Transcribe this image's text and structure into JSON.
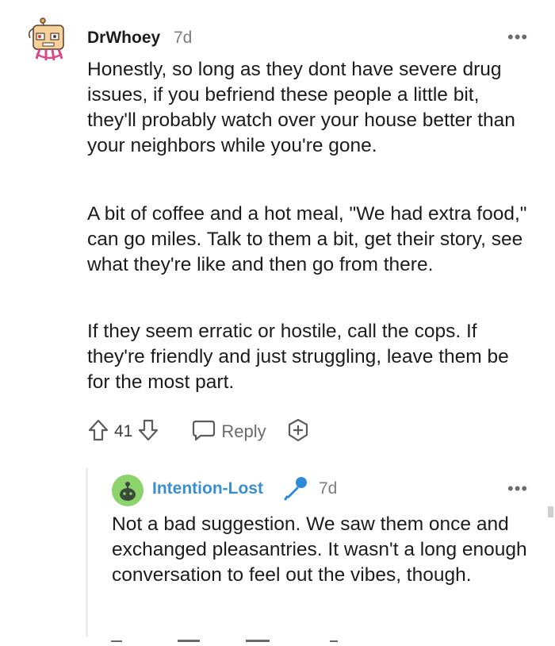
{
  "comment": {
    "username": "DrWhoey",
    "age": "7d",
    "more": "•••",
    "paragraphs": [
      "Honestly, so long as they dont have severe drug issues, if you befriend these people a little bit, they'll probably watch over your house better than your neighbors while you're gone.",
      "A bit of coffee and a hot meal, \"We had extra food,\" can go miles. Talk to them a bit, get their story, see what they're like and then go from there.",
      "If they seem erratic or hostile, call the cops. If they're friendly and just struggling, leave them be for the most part."
    ],
    "score": "41",
    "reply_label": "Reply",
    "icons": {
      "upvote": "upvote-arrow-icon",
      "downvote": "downvote-arrow-icon",
      "reply": "speech-bubble-icon",
      "award": "award-plus-icon"
    }
  },
  "reply": {
    "username": "Intention-Lost",
    "age": "7d",
    "more": "•••",
    "text": "Not a bad suggestion. We saw them once and exchanged pleasantries. It wasn't a long enough conversation to feel out the vibes, though.",
    "username_color": "#3a8fd0",
    "flair_icon": "microphone-icon"
  },
  "colors": {
    "text": "#1c1c1c",
    "meta": "#7c7c7c",
    "icon": "#6b6b6b",
    "accent": "#3a8fd0"
  }
}
